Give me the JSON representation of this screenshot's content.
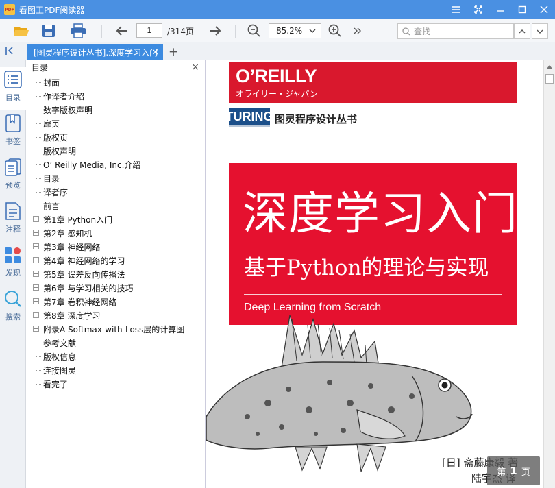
{
  "app": {
    "title": "看图王PDF阅读器",
    "logo_text": "PDF"
  },
  "toolbar": {
    "page_current": "1",
    "page_total": "/314页",
    "zoom": "85.2%",
    "search_placeholder": "查找"
  },
  "tab": {
    "label": "[图灵程序设计丛书].深度学习入门"
  },
  "rail": [
    {
      "label": "目录"
    },
    {
      "label": "书签"
    },
    {
      "label": "预览"
    },
    {
      "label": "注释"
    },
    {
      "label": "发现"
    },
    {
      "label": "搜索"
    }
  ],
  "toc": {
    "header": "目录",
    "items": [
      {
        "label": "封面",
        "expandable": false
      },
      {
        "label": "作译者介绍",
        "expandable": false
      },
      {
        "label": "数字版权声明",
        "expandable": false
      },
      {
        "label": "扉页",
        "expandable": false
      },
      {
        "label": "版权页",
        "expandable": false
      },
      {
        "label": "版权声明",
        "expandable": false
      },
      {
        "label": "O’ Reilly Media, Inc.介绍",
        "expandable": false
      },
      {
        "label": "目录",
        "expandable": false
      },
      {
        "label": "译者序",
        "expandable": false
      },
      {
        "label": "前言",
        "expandable": false
      },
      {
        "label": "第1章 Python入门",
        "expandable": true
      },
      {
        "label": "第2章 感知机",
        "expandable": true
      },
      {
        "label": "第3章 神经网络",
        "expandable": true
      },
      {
        "label": "第4章 神经网络的学习",
        "expandable": true
      },
      {
        "label": "第5章 误差反向传播法",
        "expandable": true
      },
      {
        "label": "第6章 与学习相关的技巧",
        "expandable": true
      },
      {
        "label": "第7章 卷积神经网络",
        "expandable": true
      },
      {
        "label": "第8章 深度学习",
        "expandable": true
      },
      {
        "label": "附录A Softmax-with-Loss层的计算图",
        "expandable": true
      },
      {
        "label": "参考文献",
        "expandable": false
      },
      {
        "label": "版权信息",
        "expandable": false
      },
      {
        "label": "连接图灵",
        "expandable": false
      },
      {
        "label": "看完了",
        "expandable": false
      }
    ]
  },
  "cover": {
    "publisher": "O’REILLY",
    "publisher_sub": "オライリー・ジャパン",
    "turing_logo": "TURING",
    "series": "图灵程序设计丛书",
    "title": "深度学习入门",
    "subtitle": "基于Python的理论与实现",
    "english_title": "Deep Learning from Scratch",
    "author": "[日] 斋藤康毅 著",
    "translator": "陆宇杰 译",
    "cover_red": "#e5112f"
  },
  "page_overlay": {
    "prefix": "第",
    "number": "1",
    "suffix": "页"
  }
}
